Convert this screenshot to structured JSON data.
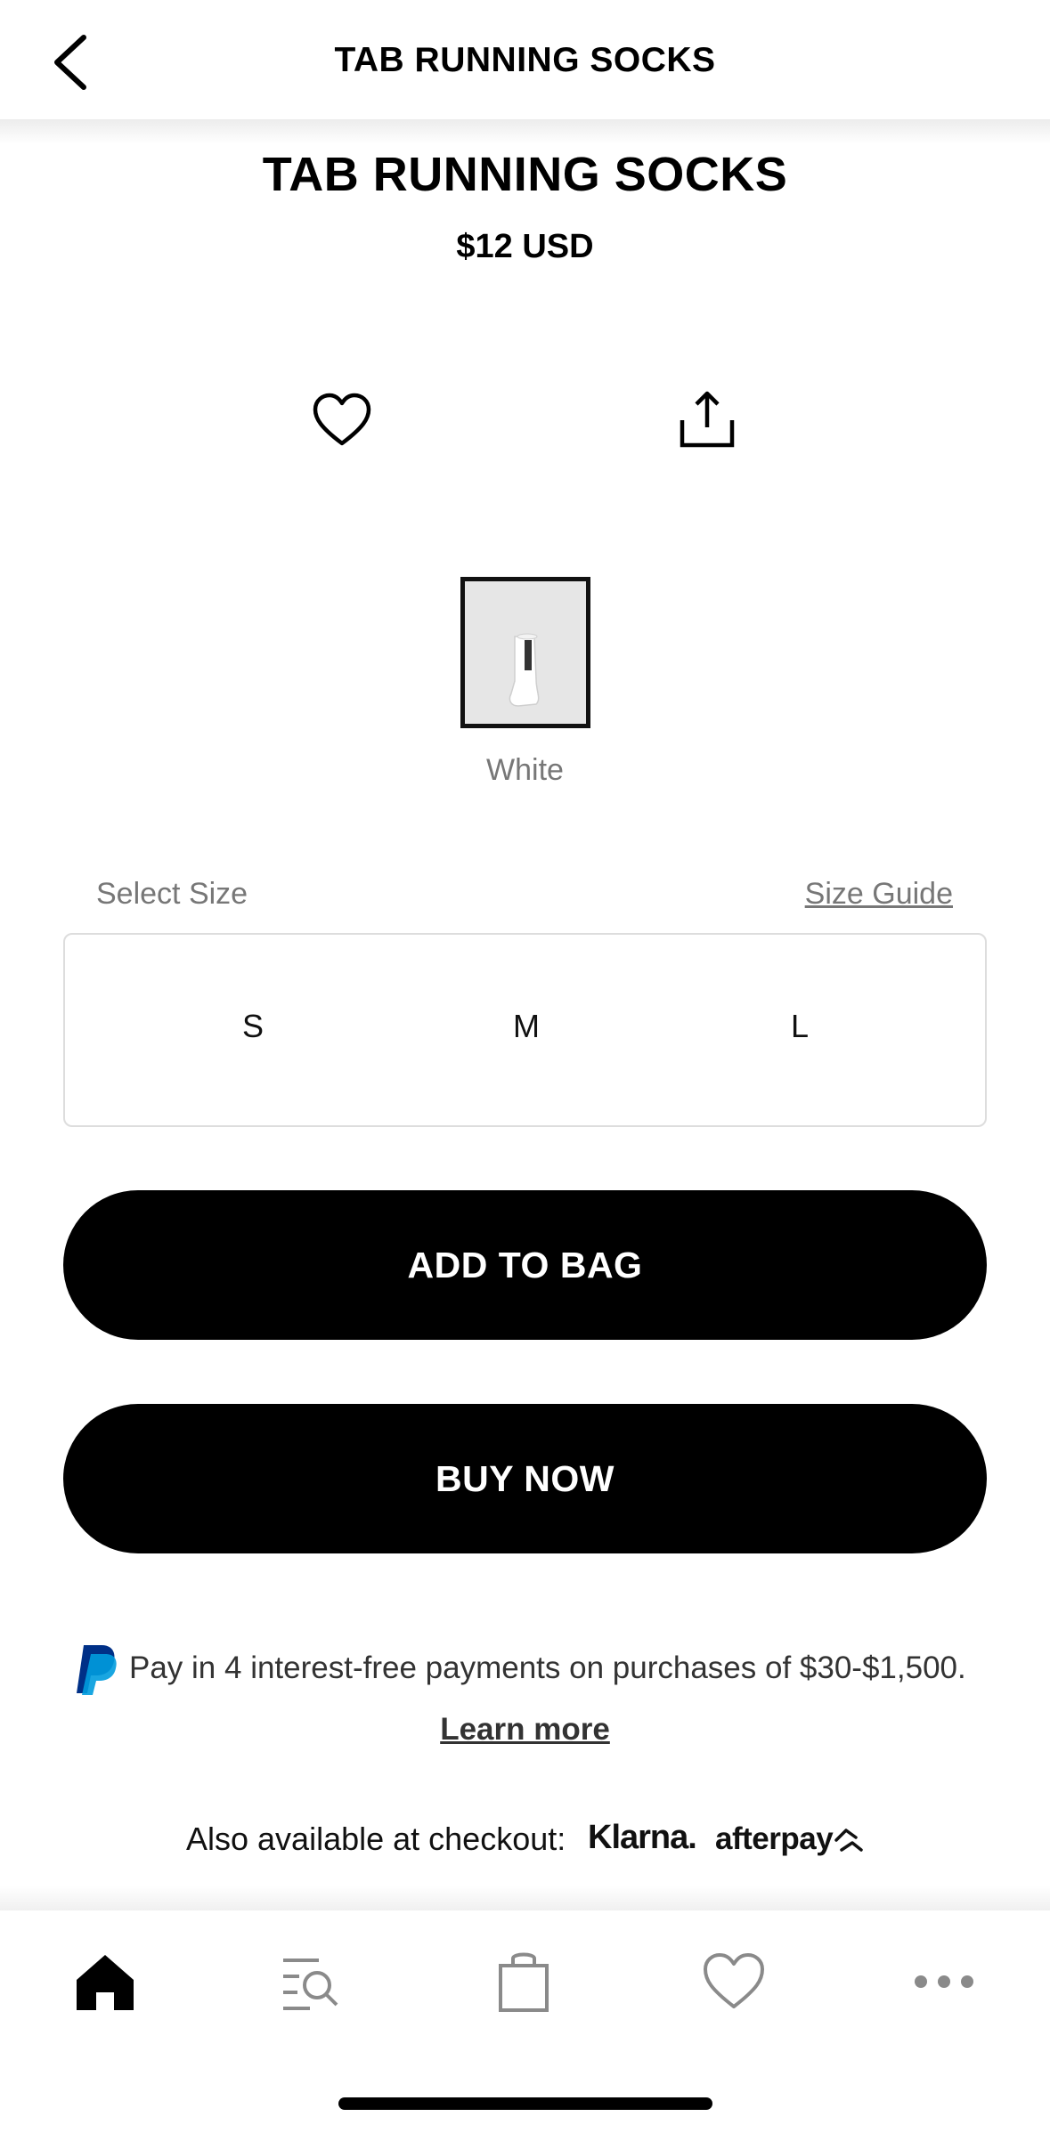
{
  "header": {
    "title": "TAB RUNNING SOCKS",
    "back_icon": "chevron-left-icon"
  },
  "product": {
    "title": "TAB RUNNING SOCKS",
    "price": "$12 USD",
    "favorite_icon": "heart-outline-icon",
    "share_icon": "share-icon"
  },
  "color": {
    "selected": "White",
    "swatch_background": "#e6e6e6"
  },
  "size": {
    "label": "Select Size",
    "guide_link": "Size Guide",
    "options": [
      "S",
      "M",
      "L"
    ]
  },
  "actions": {
    "add_to_bag": "ADD TO BAG",
    "buy_now": "BUY NOW"
  },
  "payments": {
    "paypal_text": "Pay in 4 interest-free payments on purchases of $30-$1,500.",
    "learn_more": "Learn more",
    "also_available": "Also available at checkout:",
    "klarna": "Klarna.",
    "afterpay": "afterpay",
    "paypal_colors": [
      "#003087",
      "#009cde"
    ]
  },
  "tabbar": {
    "items": [
      "home-icon",
      "search-list-icon",
      "bag-icon",
      "heart-icon",
      "more-icon"
    ],
    "active": "home-icon",
    "inactive_color": "#8a8a8a"
  }
}
